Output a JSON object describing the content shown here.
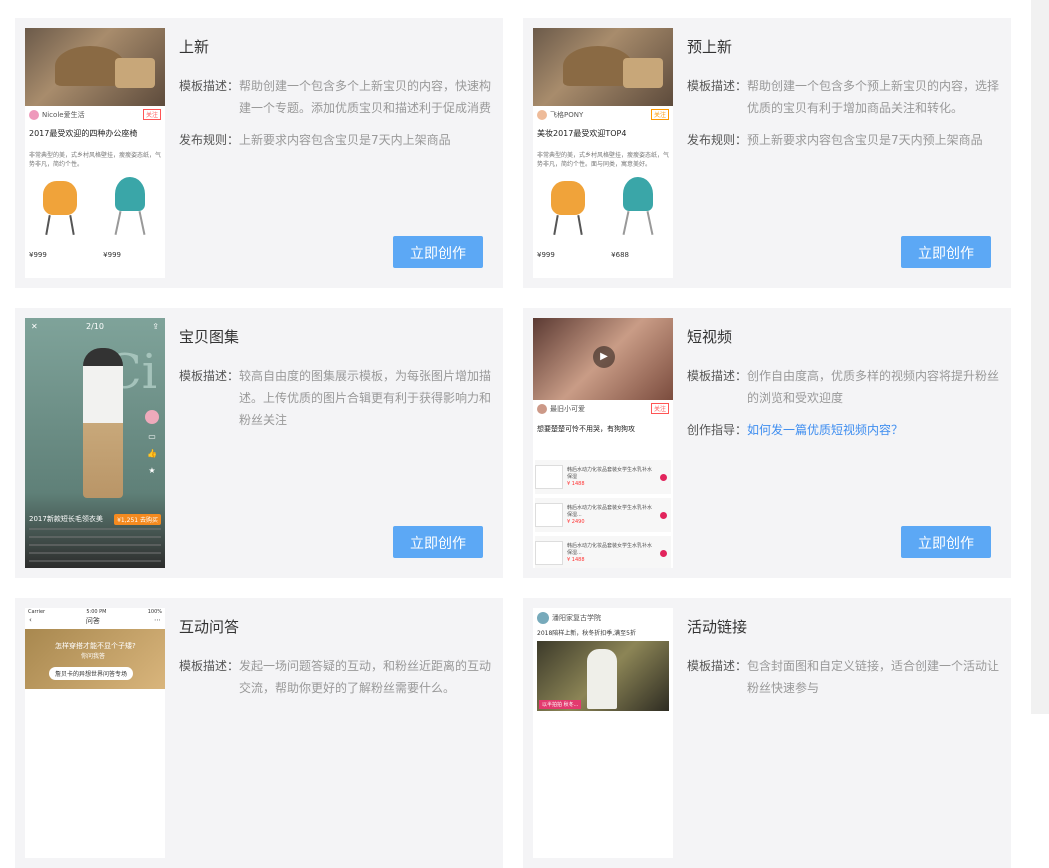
{
  "labels": {
    "desc": "模板描述：",
    "rule": "发布规则：",
    "guide": "创作指导："
  },
  "cards": [
    {
      "title": "上新",
      "desc": "帮助创建一个包含多个上新宝贝的内容，快速构建一个专题。添加优质宝贝和描述利于促成消费",
      "rule": "上新要求内容包含宝贝是7天内上架商品",
      "button": "立即创作",
      "thumb": {
        "author": "Nicole爱生活",
        "tag": "关注",
        "headline": "2017最受欢迎的四种办公座椅",
        "desc": "非常典型的美，式乡村风格壁挂，瘦瘦姿态纸，气势非凡，简约个性。",
        "price1": "¥999",
        "price2": "¥999"
      }
    },
    {
      "title": "预上新",
      "desc": "帮助创建一个包含多个预上新宝贝的内容，选择优质的宝贝有利于增加商品关注和转化。",
      "rule": "预上新要求内容包含宝贝是7天内预上架商品",
      "button": "立即创作",
      "thumb": {
        "author": "飞格PONY",
        "tag": "关注",
        "headline": "美妆2017最受欢迎TOP4",
        "desc": "非常典型的美，式乡村风格壁挂，瘦瘦姿态纸，气势非凡，简约个性。面与同类，寓意美好。",
        "price1": "¥999",
        "price2": "¥688"
      }
    },
    {
      "title": "宝贝图集",
      "desc": "较高自由度的图集展示模板，为每张图片增加描述。上传优质的图片合辑更有利于获得影响力和粉丝关注",
      "button": "立即创作",
      "thumb": {
        "counter": "2/10",
        "headline": "2017新款短长毛领衣美",
        "price": "¥1,251 去购买"
      }
    },
    {
      "title": "短视频",
      "desc": "创作自由度高，优质多样的视频内容将提升粉丝的浏览和受欢迎度",
      "guide": "如何发一篇优质短视频内容？",
      "button": "立即创作",
      "thumb": {
        "author": "最旧小可爱",
        "tag": "关注",
        "headline": "想要楚楚可怜不用哭，有狗狗攻",
        "items": [
          {
            "name": "韩后水动力化妆品套装女学生水乳补水保湿",
            "price": "¥ 1488"
          },
          {
            "name": "韩后水动力化妆品套装女学生水乳补水保湿...",
            "price": "¥ 2490"
          },
          {
            "name": "韩后水动力化妆品套装女学生水乳补水保湿...",
            "price": "¥ 1488"
          }
        ]
      }
    },
    {
      "title": "互动问答",
      "desc": "发起一场问题答疑的互动，和粉丝近距离的互动交流，帮助你更好的了解粉丝需要什么。",
      "button": "立即创作",
      "thumb": {
        "carrier": "Carrier",
        "time": "5:00 PM",
        "pct": "100%",
        "nav": "问答",
        "q1": "怎样穿搭才能不显个子矮?",
        "q2": "你问我答",
        "banner": "詹贝卡的异想世界问答专场"
      }
    },
    {
      "title": "活动链接",
      "desc": "包含封面图和自定义链接，适合创建一个活动让粉丝快速参与",
      "button": "立即创作",
      "thumb": {
        "author": "潘阳家复古学院",
        "headline": "2018陪样上新，秋冬折扣季,满至5折",
        "caption": "以半拍拍 秋冬..."
      }
    }
  ]
}
